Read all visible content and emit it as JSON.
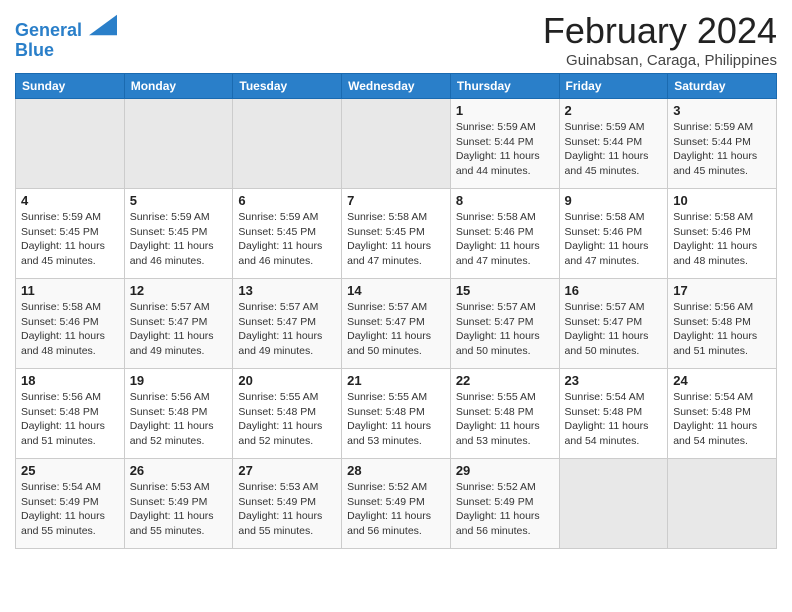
{
  "header": {
    "logo_line1": "General",
    "logo_line2": "Blue",
    "title": "February 2024",
    "subtitle": "Guinabsan, Caraga, Philippines"
  },
  "days_of_week": [
    "Sunday",
    "Monday",
    "Tuesday",
    "Wednesday",
    "Thursday",
    "Friday",
    "Saturday"
  ],
  "weeks": [
    [
      {
        "day": "",
        "info": "",
        "empty": true
      },
      {
        "day": "",
        "info": "",
        "empty": true
      },
      {
        "day": "",
        "info": "",
        "empty": true
      },
      {
        "day": "",
        "info": "",
        "empty": true
      },
      {
        "day": "1",
        "info": "Sunrise: 5:59 AM\nSunset: 5:44 PM\nDaylight: 11 hours\nand 44 minutes."
      },
      {
        "day": "2",
        "info": "Sunrise: 5:59 AM\nSunset: 5:44 PM\nDaylight: 11 hours\nand 45 minutes."
      },
      {
        "day": "3",
        "info": "Sunrise: 5:59 AM\nSunset: 5:44 PM\nDaylight: 11 hours\nand 45 minutes."
      }
    ],
    [
      {
        "day": "4",
        "info": "Sunrise: 5:59 AM\nSunset: 5:45 PM\nDaylight: 11 hours\nand 45 minutes."
      },
      {
        "day": "5",
        "info": "Sunrise: 5:59 AM\nSunset: 5:45 PM\nDaylight: 11 hours\nand 46 minutes."
      },
      {
        "day": "6",
        "info": "Sunrise: 5:59 AM\nSunset: 5:45 PM\nDaylight: 11 hours\nand 46 minutes."
      },
      {
        "day": "7",
        "info": "Sunrise: 5:58 AM\nSunset: 5:45 PM\nDaylight: 11 hours\nand 47 minutes."
      },
      {
        "day": "8",
        "info": "Sunrise: 5:58 AM\nSunset: 5:46 PM\nDaylight: 11 hours\nand 47 minutes."
      },
      {
        "day": "9",
        "info": "Sunrise: 5:58 AM\nSunset: 5:46 PM\nDaylight: 11 hours\nand 47 minutes."
      },
      {
        "day": "10",
        "info": "Sunrise: 5:58 AM\nSunset: 5:46 PM\nDaylight: 11 hours\nand 48 minutes."
      }
    ],
    [
      {
        "day": "11",
        "info": "Sunrise: 5:58 AM\nSunset: 5:46 PM\nDaylight: 11 hours\nand 48 minutes."
      },
      {
        "day": "12",
        "info": "Sunrise: 5:57 AM\nSunset: 5:47 PM\nDaylight: 11 hours\nand 49 minutes."
      },
      {
        "day": "13",
        "info": "Sunrise: 5:57 AM\nSunset: 5:47 PM\nDaylight: 11 hours\nand 49 minutes."
      },
      {
        "day": "14",
        "info": "Sunrise: 5:57 AM\nSunset: 5:47 PM\nDaylight: 11 hours\nand 50 minutes."
      },
      {
        "day": "15",
        "info": "Sunrise: 5:57 AM\nSunset: 5:47 PM\nDaylight: 11 hours\nand 50 minutes."
      },
      {
        "day": "16",
        "info": "Sunrise: 5:57 AM\nSunset: 5:47 PM\nDaylight: 11 hours\nand 50 minutes."
      },
      {
        "day": "17",
        "info": "Sunrise: 5:56 AM\nSunset: 5:48 PM\nDaylight: 11 hours\nand 51 minutes."
      }
    ],
    [
      {
        "day": "18",
        "info": "Sunrise: 5:56 AM\nSunset: 5:48 PM\nDaylight: 11 hours\nand 51 minutes."
      },
      {
        "day": "19",
        "info": "Sunrise: 5:56 AM\nSunset: 5:48 PM\nDaylight: 11 hours\nand 52 minutes."
      },
      {
        "day": "20",
        "info": "Sunrise: 5:55 AM\nSunset: 5:48 PM\nDaylight: 11 hours\nand 52 minutes."
      },
      {
        "day": "21",
        "info": "Sunrise: 5:55 AM\nSunset: 5:48 PM\nDaylight: 11 hours\nand 53 minutes."
      },
      {
        "day": "22",
        "info": "Sunrise: 5:55 AM\nSunset: 5:48 PM\nDaylight: 11 hours\nand 53 minutes."
      },
      {
        "day": "23",
        "info": "Sunrise: 5:54 AM\nSunset: 5:48 PM\nDaylight: 11 hours\nand 54 minutes."
      },
      {
        "day": "24",
        "info": "Sunrise: 5:54 AM\nSunset: 5:48 PM\nDaylight: 11 hours\nand 54 minutes."
      }
    ],
    [
      {
        "day": "25",
        "info": "Sunrise: 5:54 AM\nSunset: 5:49 PM\nDaylight: 11 hours\nand 55 minutes."
      },
      {
        "day": "26",
        "info": "Sunrise: 5:53 AM\nSunset: 5:49 PM\nDaylight: 11 hours\nand 55 minutes."
      },
      {
        "day": "27",
        "info": "Sunrise: 5:53 AM\nSunset: 5:49 PM\nDaylight: 11 hours\nand 55 minutes."
      },
      {
        "day": "28",
        "info": "Sunrise: 5:52 AM\nSunset: 5:49 PM\nDaylight: 11 hours\nand 56 minutes."
      },
      {
        "day": "29",
        "info": "Sunrise: 5:52 AM\nSunset: 5:49 PM\nDaylight: 11 hours\nand 56 minutes."
      },
      {
        "day": "",
        "info": "",
        "empty": true
      },
      {
        "day": "",
        "info": "",
        "empty": true
      }
    ]
  ]
}
